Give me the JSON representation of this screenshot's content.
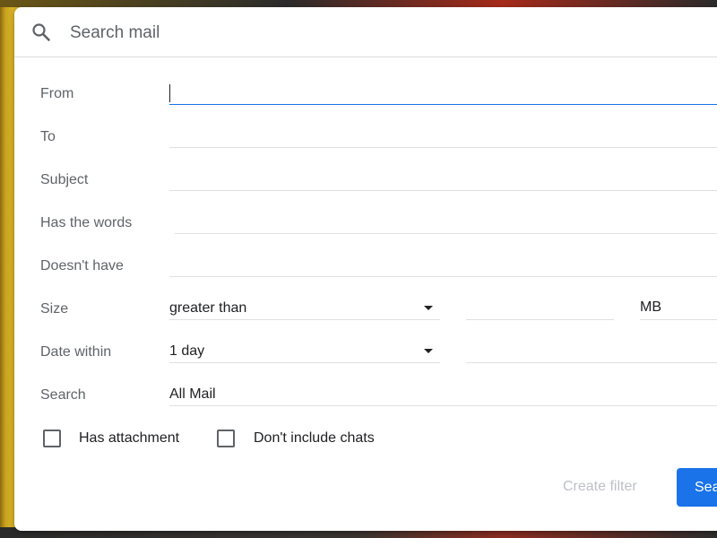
{
  "search": {
    "placeholder": "Search mail",
    "icon": "search-icon"
  },
  "form": {
    "from_label": "From",
    "to_label": "To",
    "subject_label": "Subject",
    "has_words_label": "Has the words",
    "doesnt_have_label": "Doesn't have",
    "size_label": "Size",
    "size_operator": "greater than",
    "size_unit": "MB",
    "date_within_label": "Date within",
    "date_within_value": "1 day",
    "search_label": "Search",
    "search_scope": "All Mail",
    "has_attachment_label": "Has attachment",
    "dont_include_chats_label": "Don't include chats"
  },
  "actions": {
    "create_filter_label": "Create filter",
    "search_button_label": "Search"
  },
  "colors": {
    "accent": "#1a73e8",
    "disabled_text": "#bdc1c6",
    "label_text": "#5f6368"
  }
}
